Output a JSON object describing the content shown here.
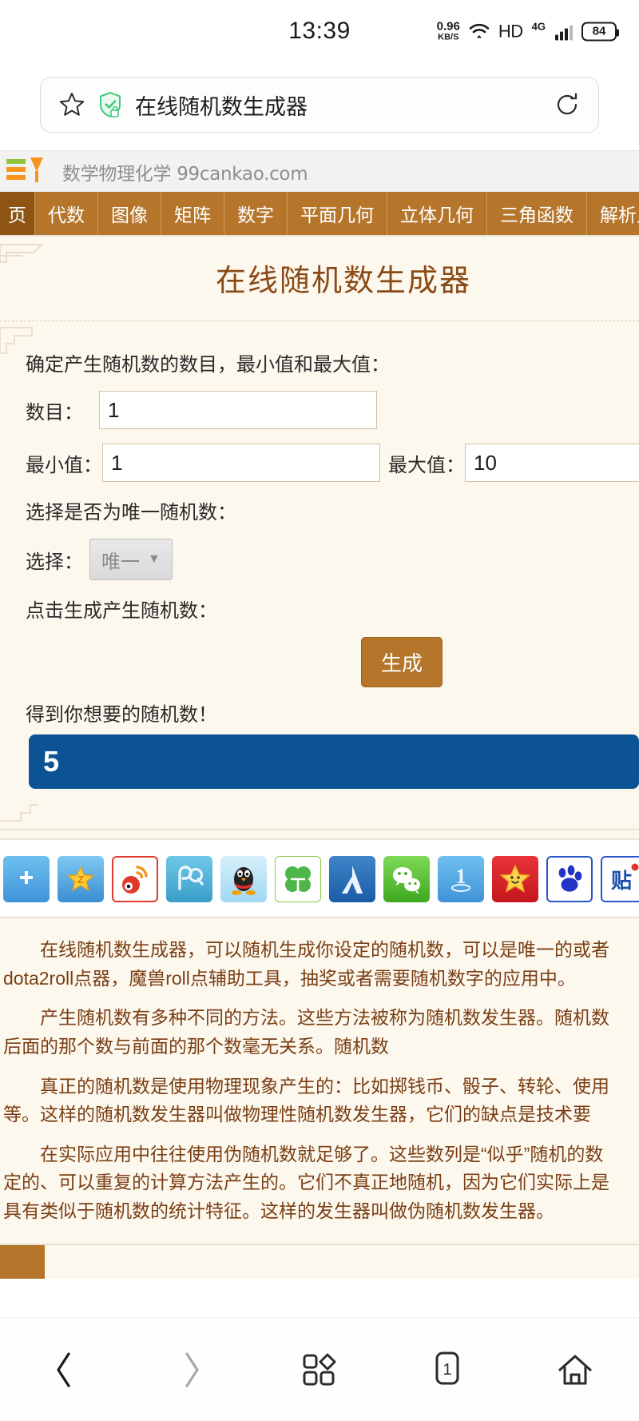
{
  "status_bar": {
    "time": "13:39",
    "net_speed_value": "0.96",
    "net_speed_unit": "KB/S",
    "wifi_icon": "wifi-icon",
    "hd_label": "HD",
    "network_label": "4G",
    "network_plus": "+",
    "signal_icon": "signal-bars-icon",
    "battery_level": "84"
  },
  "browser": {
    "star_icon": "star-icon",
    "shield_icon": "shield-secure-icon",
    "page_title": "在线随机数生成器",
    "reload_icon": "reload-icon"
  },
  "site": {
    "logo_icon": "site-logo-icon",
    "name": "数学物理化学 99cankao.com",
    "nav": [
      {
        "label": "页",
        "active": true
      },
      {
        "label": "代数",
        "active": false
      },
      {
        "label": "图像",
        "active": false
      },
      {
        "label": "矩阵",
        "active": false
      },
      {
        "label": "数字",
        "active": false
      },
      {
        "label": "平面几何",
        "active": false
      },
      {
        "label": "立体几何",
        "active": false
      },
      {
        "label": "三角函数",
        "active": false
      },
      {
        "label": "解析几何",
        "active": false
      }
    ]
  },
  "tool": {
    "title": "在线随机数生成器",
    "lead": "确定产生随机数的数目，最小值和最大值：",
    "count_label": "数目：",
    "count_value": "1",
    "min_label": "最小值：",
    "min_value": "1",
    "max_label": "最大值：",
    "max_value": "10",
    "unique_lead": "选择是否为唯一随机数：",
    "select_label": "选择：",
    "select_value": "唯一",
    "select_caret": "chevron-down-icon",
    "generate_lead": "点击生成产生随机数：",
    "generate_button": "生成",
    "result_label": "得到你想要的随机数！",
    "result_value": "5"
  },
  "share": {
    "icons": [
      {
        "name": "jiathis-plus-icon",
        "glyph": "+",
        "bg": "#4ba3e3",
        "fg": "#ffffff"
      },
      {
        "name": "qzone-icon",
        "glyph": "★",
        "bg": "#ffd24a",
        "fg": "#f0a71a"
      },
      {
        "name": "sina-weibo-icon",
        "glyph": "",
        "bg": "#e94a3a",
        "fg": "#ffffff"
      },
      {
        "name": "qq-weibo-icon",
        "glyph": "",
        "bg": "#44b6e0",
        "fg": "#ffffff"
      },
      {
        "name": "qq-penguin-icon",
        "glyph": "",
        "bg": "#bfe7fa",
        "fg": "#2a2a2a"
      },
      {
        "name": "kaixin-clover-icon",
        "glyph": "",
        "bg": "#ffffff",
        "fg": "#46b03a"
      },
      {
        "name": "renren-icon",
        "glyph": "人",
        "bg": "#1b64b4",
        "fg": "#ffffff"
      },
      {
        "name": "wechat-icon",
        "glyph": "",
        "bg": "#4fc03a",
        "fg": "#ffffff"
      },
      {
        "name": "yiqifa-one-icon",
        "glyph": "1",
        "bg": "#4ba3e3",
        "fg": "#ffffff"
      },
      {
        "name": "star-share-icon",
        "glyph": "★",
        "bg": "#e0252c",
        "fg": "#ffd24a"
      },
      {
        "name": "baidu-paw-icon",
        "glyph": "",
        "bg": "#ffffff",
        "fg": "#2334c7"
      },
      {
        "name": "baidu-tieba-icon",
        "glyph": "贴",
        "bg": "#ffffff",
        "fg": "#1b4fa8"
      }
    ]
  },
  "article": {
    "paragraphs": [
      [
        "在线随机数生成器，可以随机生成你设定的随机数，可以是唯一的或者",
        "dota2roll点器，魔兽roll点辅助工具，抽奖或者需要随机数字的应用中。"
      ],
      [
        "产生随机数有多种不同的方法。这些方法被称为随机数发生器。随机数",
        "后面的那个数与前面的那个数毫无关系。随机数"
      ],
      [
        "真正的随机数是使用物理现象产生的：比如掷钱币、骰子、转轮、使用",
        "等。这样的随机数发生器叫做物理性随机数发生器，它们的缺点是技术要"
      ],
      [
        "在实际应用中往往使用伪随机数就足够了。这些数列是“似乎”随机的数",
        "定的、可以重复的计算方法产生的。它们不真正地随机，因为它们实际上是",
        "具有类似于随机数的统计特征。这样的发生器叫做伪随机数发生器。"
      ]
    ]
  },
  "bottom_nav": {
    "back_icon": "chevron-left-icon",
    "forward_icon": "chevron-right-icon",
    "menu_icon": "grid-menu-icon",
    "tabs_icon": "tab-count-icon",
    "tab_count": "1",
    "home_icon": "home-icon"
  },
  "colors": {
    "brand_brown": "#b5762c",
    "brand_brown_dark": "#8e5414",
    "page_bg": "#fdf8ee",
    "result_blue": "#0b5394",
    "title_brown": "#8a4a17",
    "article_text": "#7a3e14"
  }
}
